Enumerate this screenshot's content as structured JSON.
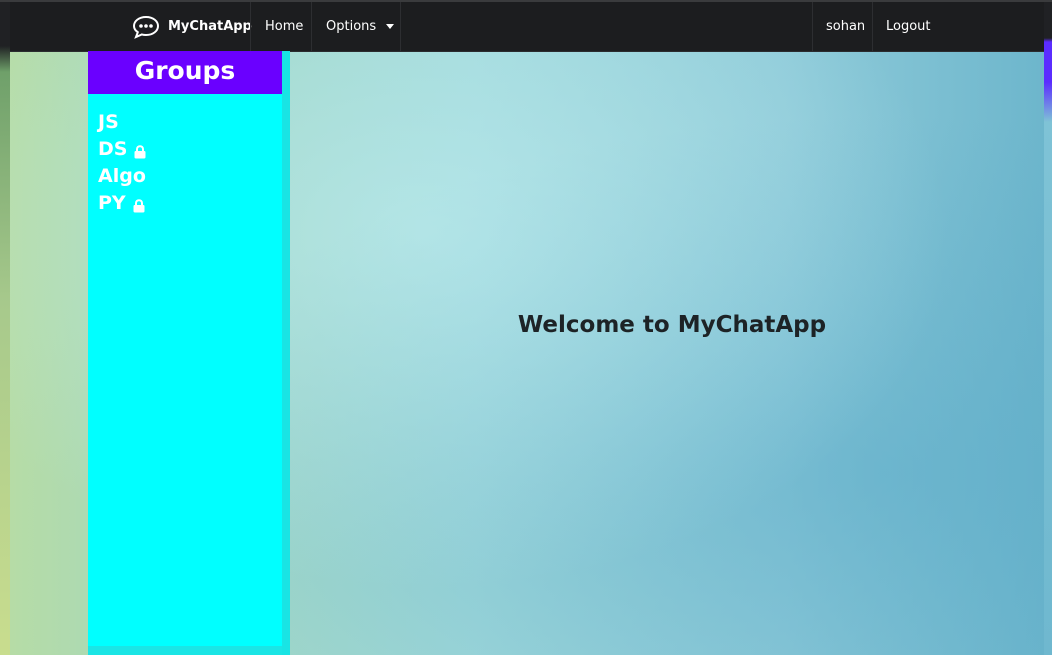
{
  "navbar": {
    "brand": "MyChatApp",
    "home": "Home",
    "options": "Options",
    "user": "sohan",
    "logout": "Logout"
  },
  "sidebar": {
    "title": "Groups",
    "groups": [
      {
        "name": "JS",
        "locked": false
      },
      {
        "name": "DS",
        "locked": true
      },
      {
        "name": "Algo",
        "locked": false
      },
      {
        "name": "PY",
        "locked": true
      }
    ]
  },
  "main": {
    "welcome": "Welcome to MyChatApp"
  },
  "colors": {
    "navbar": "#1c1d1f",
    "sidebar_header": "#6a00ff",
    "sidebar_body": "#00ffff"
  },
  "icons": {
    "brand": "chat-bubble-icon",
    "options": "caret-down-icon",
    "private_group": "lock-icon"
  }
}
